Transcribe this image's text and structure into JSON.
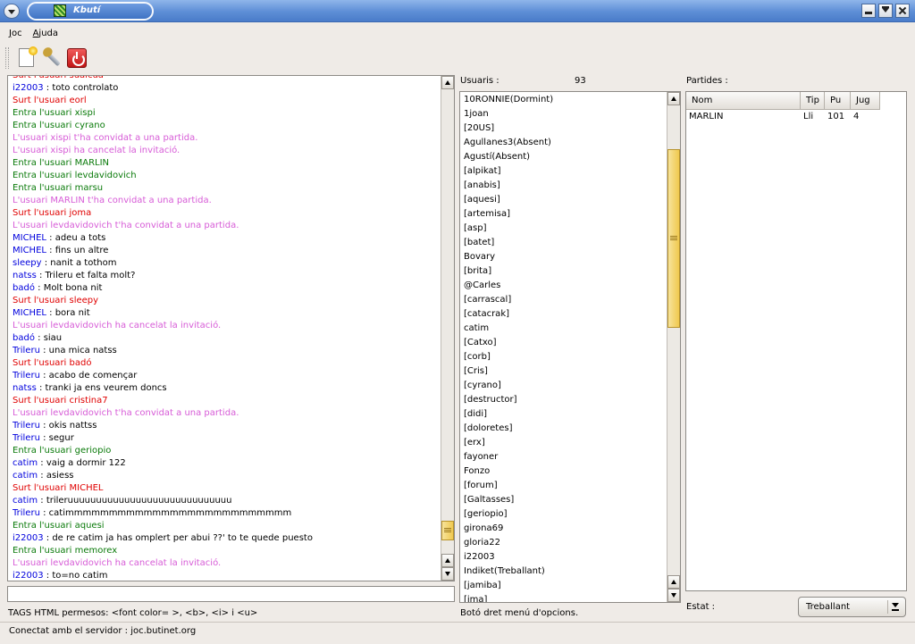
{
  "window": {
    "title": "Kbutí"
  },
  "menu": [
    {
      "mnemonic": "J",
      "rest": "oc"
    },
    {
      "mnemonic": "A",
      "rest": "juda"
    }
  ],
  "toolbar": {
    "icons": [
      "new-game-icon",
      "settings-wrench-icon",
      "power-disconnect-icon"
    ]
  },
  "chat": {
    "lines": [
      {
        "kind": "out",
        "text": "Surt l'usuari sualcua"
      },
      {
        "kind": "msg",
        "nick": "i22003",
        "text": "toto controlato"
      },
      {
        "kind": "out",
        "text": "Surt l'usuari eorl"
      },
      {
        "kind": "in",
        "text": "Entra l'usuari xispi"
      },
      {
        "kind": "in",
        "text": "Entra l'usuari cyrano"
      },
      {
        "kind": "invite",
        "text": "L'usuari xispi t'ha convidat a una partida."
      },
      {
        "kind": "invite",
        "text": "L'usuari xispi ha cancelat la invitació."
      },
      {
        "kind": "in",
        "text": "Entra l'usuari MARLIN"
      },
      {
        "kind": "in",
        "text": "Entra l'usuari levdavidovich"
      },
      {
        "kind": "in",
        "text": "Entra l'usuari marsu"
      },
      {
        "kind": "invite",
        "text": "L'usuari MARLIN t'ha convidat a una partida."
      },
      {
        "kind": "out",
        "text": "Surt l'usuari joma"
      },
      {
        "kind": "invite",
        "text": "L'usuari levdavidovich t'ha convidat a una partida."
      },
      {
        "kind": "msg",
        "nick": "MICHEL",
        "text": "adeu a tots"
      },
      {
        "kind": "msg",
        "nick": "MICHEL",
        "text": "fins un altre"
      },
      {
        "kind": "msg",
        "nick": "sleepy",
        "text": "nanit a tothom"
      },
      {
        "kind": "msg",
        "nick": "natss",
        "text": "Trileru et falta molt?"
      },
      {
        "kind": "msg",
        "nick": "badó",
        "text": "Molt bona nit"
      },
      {
        "kind": "out",
        "text": "Surt l'usuari sleepy"
      },
      {
        "kind": "msg",
        "nick": "MICHEL",
        "text": "bora nit"
      },
      {
        "kind": "invite",
        "text": "L'usuari levdavidovich ha cancelat la invitació."
      },
      {
        "kind": "msg",
        "nick": "badó",
        "text": "siau"
      },
      {
        "kind": "msg",
        "nick": "Trileru",
        "text": "una mica natss"
      },
      {
        "kind": "out",
        "text": "Surt l'usuari badó"
      },
      {
        "kind": "msg",
        "nick": "Trileru",
        "text": "acabo de començar"
      },
      {
        "kind": "msg",
        "nick": "natss",
        "text": "tranki ja ens veurem doncs"
      },
      {
        "kind": "out",
        "text": "Surt l'usuari cristina7"
      },
      {
        "kind": "invite",
        "text": "L'usuari levdavidovich t'ha convidat a una partida."
      },
      {
        "kind": "msg",
        "nick": "Trileru",
        "text": "okis nattss"
      },
      {
        "kind": "msg",
        "nick": "Trileru",
        "text": "segur"
      },
      {
        "kind": "in",
        "text": "Entra l'usuari geriopio"
      },
      {
        "kind": "msg",
        "nick": "catim",
        "text": "vaig a dormir 122"
      },
      {
        "kind": "msg",
        "nick": "catim",
        "text": "asiess"
      },
      {
        "kind": "out",
        "text": "Surt l'usuari MICHEL"
      },
      {
        "kind": "msg",
        "nick": "catim",
        "text": "trileruuuuuuuuuuuuuuuuuuuuuuuuuuuuu"
      },
      {
        "kind": "msg",
        "nick": "Trileru",
        "text": "catimmmmmmmmmmmmmmmmmmmmmmmmmm"
      },
      {
        "kind": "in",
        "text": "Entra l'usuari aquesi"
      },
      {
        "kind": "msg",
        "nick": "i22003",
        "text": "de re catim ja has omplert per abui ??' to te quede puesto"
      },
      {
        "kind": "in",
        "text": "Entra l'usuari memorex"
      },
      {
        "kind": "invite",
        "text": "L'usuari levdavidovich ha cancelat la invitació."
      },
      {
        "kind": "msg",
        "nick": "i22003",
        "text": "to=no catim"
      }
    ],
    "input_value": "",
    "tags_hint": "TAGS HTML permesos: <font color= >, <b>, <i> i <u>",
    "scroll_position": 0.97
  },
  "users": {
    "label": "Usuaris :",
    "count": "93",
    "items": [
      "10RONNIE(Dormint)",
      "1joan",
      "[20US]",
      "Agullanes3(Absent)",
      "Agustí(Absent)",
      "[alpikat]",
      "[anabis]",
      "[aquesi]",
      "[artemisa]",
      "[asp]",
      "[batet]",
      "Bovary",
      "[brita]",
      "@Carles",
      "[carrascal]",
      "[catacrak]",
      "catim",
      "[Catxo]",
      "[corb]",
      "[Cris]",
      "[cyrano]",
      "[destructor]",
      "[didi]",
      "[doloretes]",
      "[erx]",
      "fayoner",
      "Fonzo",
      "[forum]",
      "[Galtasses]",
      "[geriopio]",
      "girona69",
      "gloria22",
      "i22003",
      "Indiket(Treballant)",
      "[jamiba]",
      "[jma]"
    ],
    "hint": "Botó dret menú d'opcions.",
    "scroll_position": 0.15
  },
  "games": {
    "label": "Partides :",
    "columns": [
      "Nom",
      "Tip",
      "Pu",
      "Jug"
    ],
    "rows": [
      {
        "nom": "MARLIN",
        "tip": "Lli",
        "pu": "101",
        "jug": "4"
      }
    ]
  },
  "estat": {
    "label": "Estat :",
    "value": "Treballant"
  },
  "statusbar": {
    "text": "Conectat amb el servidor : joc.butinet.org"
  }
}
